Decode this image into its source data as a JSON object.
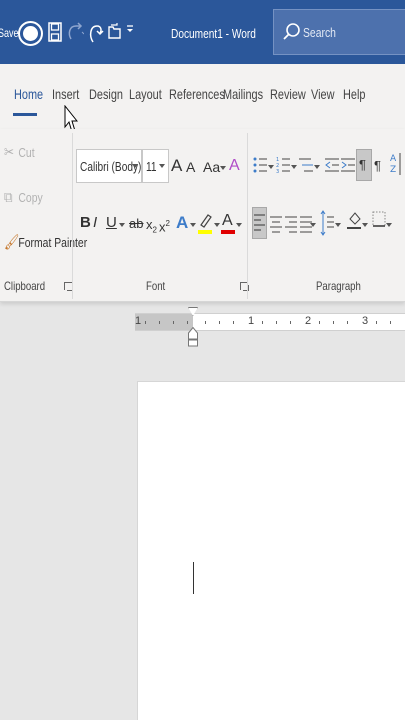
{
  "titlebar": {
    "autosave_label": "Save",
    "title": "Document1 - Word",
    "search_placeholder": "Search"
  },
  "tabs": [
    "Home",
    "Insert",
    "Design",
    "Layout",
    "References",
    "Mailings",
    "Review",
    "View",
    "Help"
  ],
  "active_tab": "Home",
  "clipboard": {
    "cut": "Cut",
    "copy": "Copy",
    "format_painter": "Format Painter",
    "group_label": "Clipboard"
  },
  "font": {
    "family": "Calibri (Body)",
    "size": "11",
    "group_label": "Font",
    "bold": "B",
    "italic": "I",
    "underline": "U",
    "strikethrough": "ab",
    "subscript": "x",
    "superscript": "x",
    "grow": "A",
    "shrink": "A",
    "change_case": "Aa",
    "text_effects": "A",
    "font_color": "A",
    "highlight_color": "#ffff00",
    "font_color_value": "#e00000"
  },
  "paragraph": {
    "group_label": "Paragraph"
  },
  "ruler": {
    "numbers": [
      "1",
      "1",
      "2",
      "3"
    ]
  }
}
